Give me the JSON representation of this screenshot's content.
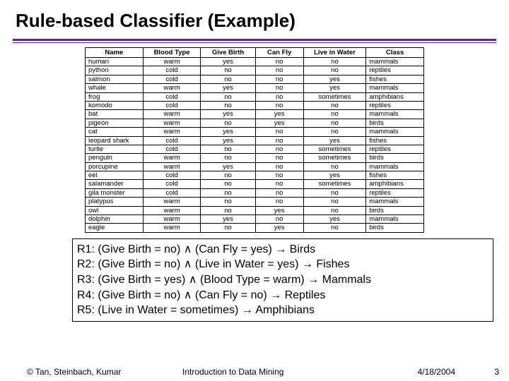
{
  "title": "Rule-based Classifier (Example)",
  "table": {
    "headers": [
      "Name",
      "Blood Type",
      "Give Birth",
      "Can Fly",
      "Live in Water",
      "Class"
    ],
    "rows": [
      [
        "human",
        "warm",
        "yes",
        "no",
        "no",
        "mammals"
      ],
      [
        "python",
        "cold",
        "no",
        "no",
        "no",
        "reptiles"
      ],
      [
        "salmon",
        "cold",
        "no",
        "no",
        "yes",
        "fishes"
      ],
      [
        "whale",
        "warm",
        "yes",
        "no",
        "yes",
        "mammals"
      ],
      [
        "frog",
        "cold",
        "no",
        "no",
        "sometimes",
        "amphibians"
      ],
      [
        "komodo",
        "cold",
        "no",
        "no",
        "no",
        "reptiles"
      ],
      [
        "bat",
        "warm",
        "yes",
        "yes",
        "no",
        "mammals"
      ],
      [
        "pigeon",
        "warm",
        "no",
        "yes",
        "no",
        "birds"
      ],
      [
        "cat",
        "warm",
        "yes",
        "no",
        "no",
        "mammals"
      ],
      [
        "leopard shark",
        "cold",
        "yes",
        "no",
        "yes",
        "fishes"
      ],
      [
        "turtle",
        "cold",
        "no",
        "no",
        "sometimes",
        "reptiles"
      ],
      [
        "penguin",
        "warm",
        "no",
        "no",
        "sometimes",
        "birds"
      ],
      [
        "porcupine",
        "warm",
        "yes",
        "no",
        "no",
        "mammals"
      ],
      [
        "eel",
        "cold",
        "no",
        "no",
        "yes",
        "fishes"
      ],
      [
        "salamander",
        "cold",
        "no",
        "no",
        "sometimes",
        "amphibians"
      ],
      [
        "gila monster",
        "cold",
        "no",
        "no",
        "no",
        "reptiles"
      ],
      [
        "platypus",
        "warm",
        "no",
        "no",
        "no",
        "mammals"
      ],
      [
        "owl",
        "warm",
        "no",
        "yes",
        "no",
        "birds"
      ],
      [
        "dolphin",
        "warm",
        "yes",
        "no",
        "yes",
        "mammals"
      ],
      [
        "eagle",
        "warm",
        "no",
        "yes",
        "no",
        "birds"
      ]
    ]
  },
  "rules": [
    "R1: (Give Birth = no) ∧ (Can Fly = yes) → Birds",
    "R2: (Give Birth = no) ∧ (Live in Water = yes) → Fishes",
    "R3: (Give Birth = yes) ∧ (Blood Type = warm) → Mammals",
    "R4: (Give Birth = no) ∧ (Can Fly = no) → Reptiles",
    "R5: (Live in Water = sometimes) → Amphibians"
  ],
  "footer": {
    "copyright": "© Tan, Steinbach, Kumar",
    "course": "Introduction to Data Mining",
    "date": "4/18/2004",
    "page": "3"
  }
}
